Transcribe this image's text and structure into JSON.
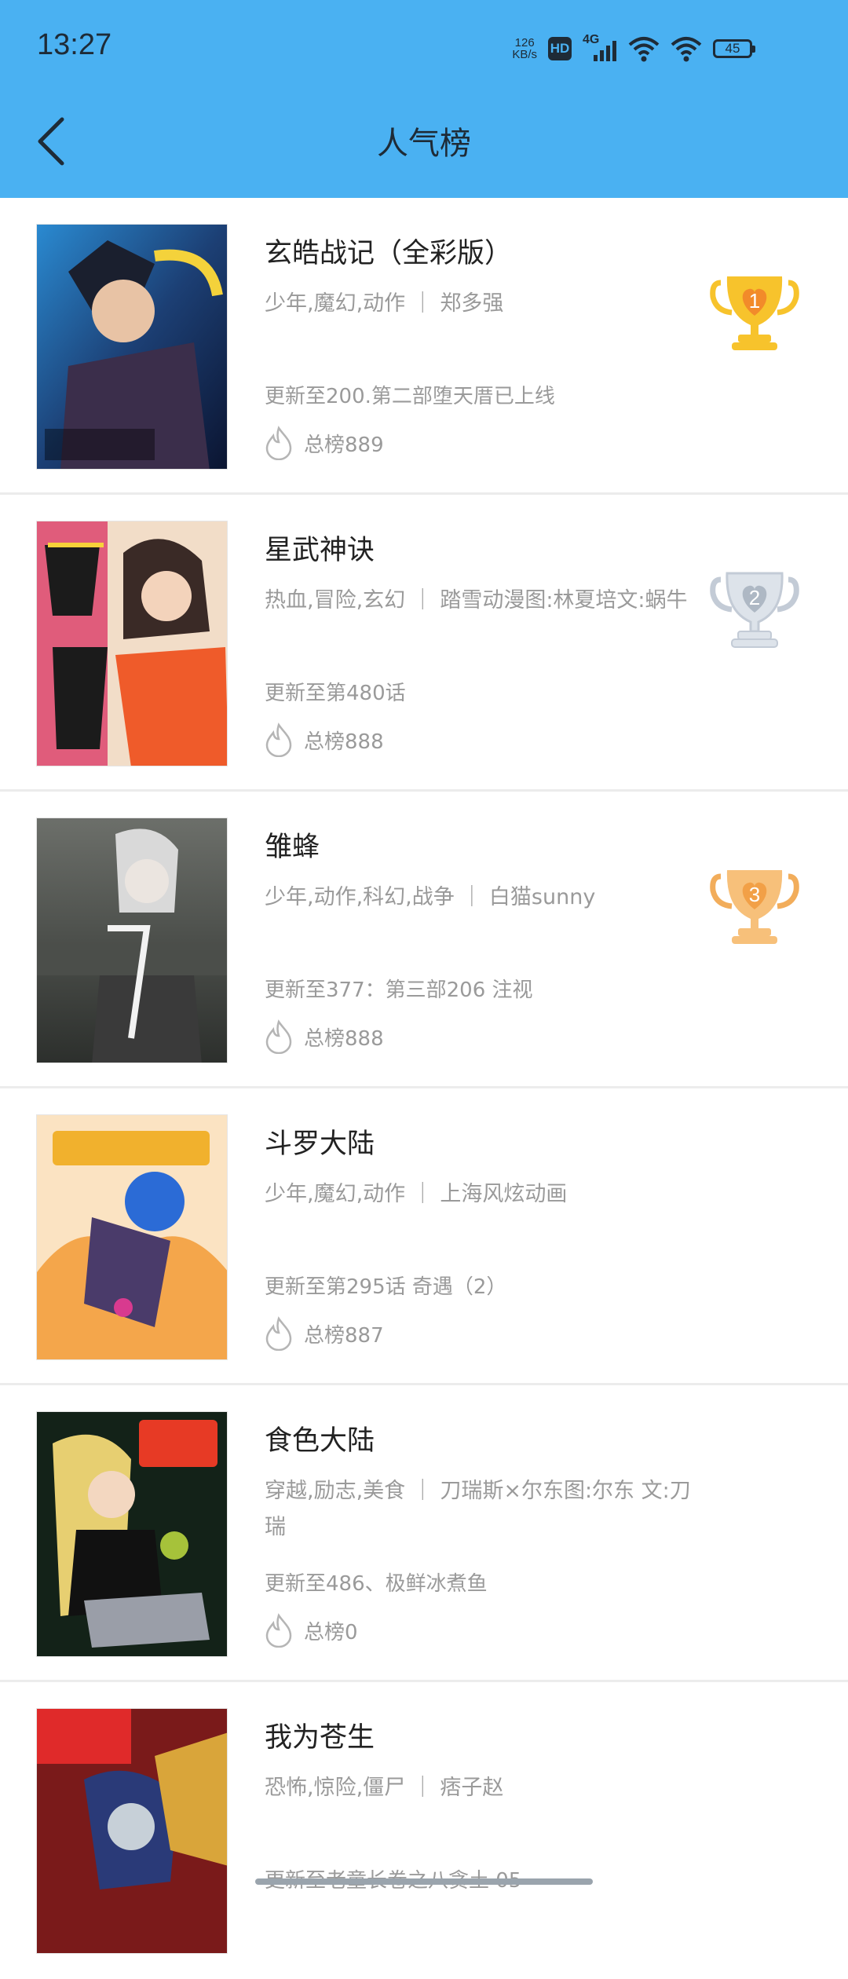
{
  "status": {
    "time": "13:27",
    "net_speed_value": "126",
    "net_speed_unit": "KB/s",
    "hd": "HD",
    "network": "4G",
    "battery": "45"
  },
  "header": {
    "title": "人气榜"
  },
  "items": [
    {
      "name": "玄皓战记（全彩版）",
      "tags": "少年,魔幻,动作 ｜ 郑多强",
      "update": "更新至200.第二部堕天厝已上线",
      "rank_label": "总榜889",
      "trophy": "1"
    },
    {
      "name": "星武神诀",
      "tags": "热血,冒险,玄幻 ｜ 踏雪动漫图:林夏培文:蜗牛",
      "update": "更新至第480话",
      "rank_label": "总榜888",
      "trophy": "2"
    },
    {
      "name": "雏蜂",
      "tags": "少年,动作,科幻,战争 ｜ 白猫sunny",
      "update": "更新至377：第三部206 注视",
      "rank_label": "总榜888",
      "trophy": "3"
    },
    {
      "name": "斗罗大陆",
      "tags": "少年,魔幻,动作 ｜ 上海风炫动画",
      "update": "更新至第295话 奇遇（2）",
      "rank_label": "总榜887"
    },
    {
      "name": "食色大陆",
      "tags": "穿越,励志,美食 ｜ 刀瑞斯×尔东图:尔东 文:刀瑞",
      "update": "更新至486、极鲜冰煮鱼",
      "rank_label": "总榜0"
    },
    {
      "name": "我为苍生",
      "tags": "恐怖,惊险,僵尸 ｜ 痞子赵",
      "update": "更新至老童长卷之八贪土 05",
      "rank_label": ""
    }
  ],
  "colors": {
    "header_bg": "#4ab1f2",
    "gold": "#f7c32c",
    "silver": "#c3cbd6",
    "bronze": "#f2ad5b"
  }
}
